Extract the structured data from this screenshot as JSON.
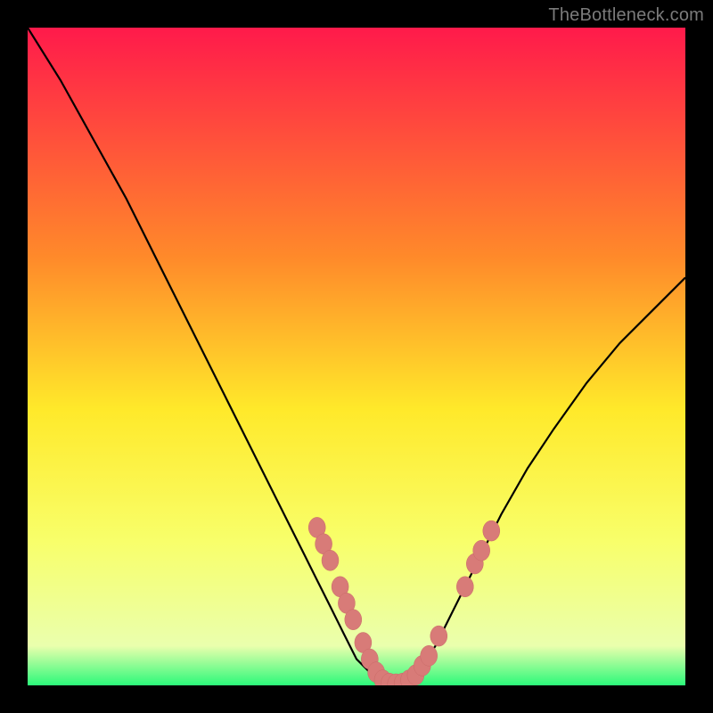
{
  "attribution": "TheBottleneck.com",
  "colors": {
    "frame": "#000000",
    "gradient_top": "#ff1a4b",
    "gradient_mid_upper": "#ff8a2a",
    "gradient_mid": "#ffe92a",
    "gradient_lower": "#f8ff6a",
    "gradient_base": "#2cf97a",
    "curve": "#000000",
    "dot_fill": "#d87b78",
    "dot_stroke": "#c96a67"
  },
  "plot": {
    "inner_x": 31,
    "inner_y": 31,
    "inner_w": 738,
    "inner_h": 738
  },
  "chart_data": {
    "type": "line",
    "title": "",
    "xlabel": "",
    "ylabel": "",
    "xlim": [
      0,
      100
    ],
    "ylim": [
      0,
      100
    ],
    "grid": false,
    "legend": false,
    "series": [
      {
        "name": "bottleneck-curve",
        "x": [
          0,
          5,
          10,
          15,
          20,
          25,
          30,
          35,
          40,
          42,
          44,
          46,
          48,
          50,
          52,
          54,
          56,
          58,
          60,
          62,
          64,
          68,
          72,
          76,
          80,
          85,
          90,
          95,
          100
        ],
        "y": [
          100,
          92,
          83,
          74,
          64,
          54,
          44,
          34,
          24,
          20,
          16,
          12,
          8,
          4,
          2,
          0,
          0,
          1,
          3,
          6,
          10,
          18,
          26,
          33,
          39,
          46,
          52,
          57,
          62
        ]
      }
    ],
    "markers": [
      {
        "x": 44.0,
        "y": 24.0
      },
      {
        "x": 45.0,
        "y": 21.5
      },
      {
        "x": 46.0,
        "y": 19.0
      },
      {
        "x": 47.5,
        "y": 15.0
      },
      {
        "x": 48.5,
        "y": 12.5
      },
      {
        "x": 49.5,
        "y": 10.0
      },
      {
        "x": 51.0,
        "y": 6.5
      },
      {
        "x": 52.0,
        "y": 4.0
      },
      {
        "x": 53.0,
        "y": 2.0
      },
      {
        "x": 54.0,
        "y": 0.8
      },
      {
        "x": 55.0,
        "y": 0.3
      },
      {
        "x": 56.0,
        "y": 0.2
      },
      {
        "x": 57.0,
        "y": 0.3
      },
      {
        "x": 58.0,
        "y": 0.8
      },
      {
        "x": 59.0,
        "y": 1.6
      },
      {
        "x": 60.0,
        "y": 3.0
      },
      {
        "x": 61.0,
        "y": 4.5
      },
      {
        "x": 62.5,
        "y": 7.5
      },
      {
        "x": 66.5,
        "y": 15.0
      },
      {
        "x": 68.0,
        "y": 18.5
      },
      {
        "x": 69.0,
        "y": 20.5
      },
      {
        "x": 70.5,
        "y": 23.5
      }
    ]
  }
}
